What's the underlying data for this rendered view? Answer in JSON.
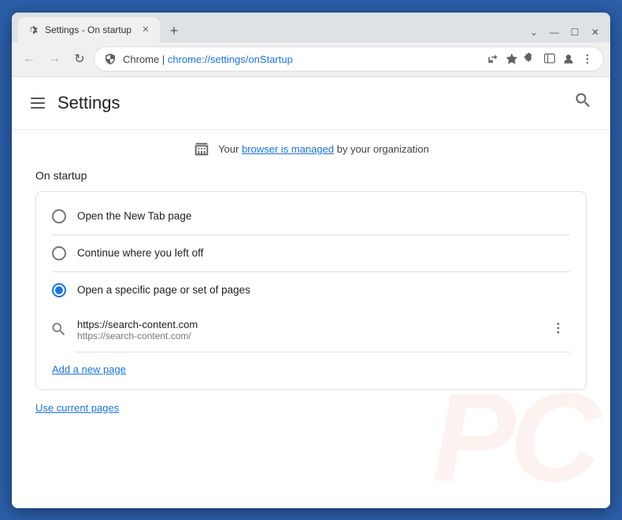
{
  "window": {
    "title": "Settings - On startup",
    "tab_label": "Settings - On startup",
    "url_chrome": "Chrome",
    "url_path": "chrome://settings/onStartup",
    "controls": {
      "minimize": "—",
      "maximize": "☐",
      "close": "✕",
      "newtab": "+"
    }
  },
  "toolbar": {
    "back": "←",
    "forward": "→",
    "refresh": "↻"
  },
  "header": {
    "menu_icon": "≡",
    "title": "Settings",
    "search_icon": "🔍"
  },
  "managed_notice": {
    "prefix": "Your ",
    "link": "browser is managed",
    "suffix": " by your organization"
  },
  "startup_section": {
    "label": "On startup",
    "options": [
      {
        "id": "new-tab",
        "label": "Open the New Tab page",
        "selected": false
      },
      {
        "id": "continue",
        "label": "Continue where you left off",
        "selected": false
      },
      {
        "id": "specific",
        "label": "Open a specific page or set of pages",
        "selected": true
      }
    ],
    "url_entry": {
      "main": "https://search-content.com",
      "sub": "https://search-content.com/"
    },
    "add_page_link": "Add a new page",
    "use_current_link": "Use current pages"
  }
}
